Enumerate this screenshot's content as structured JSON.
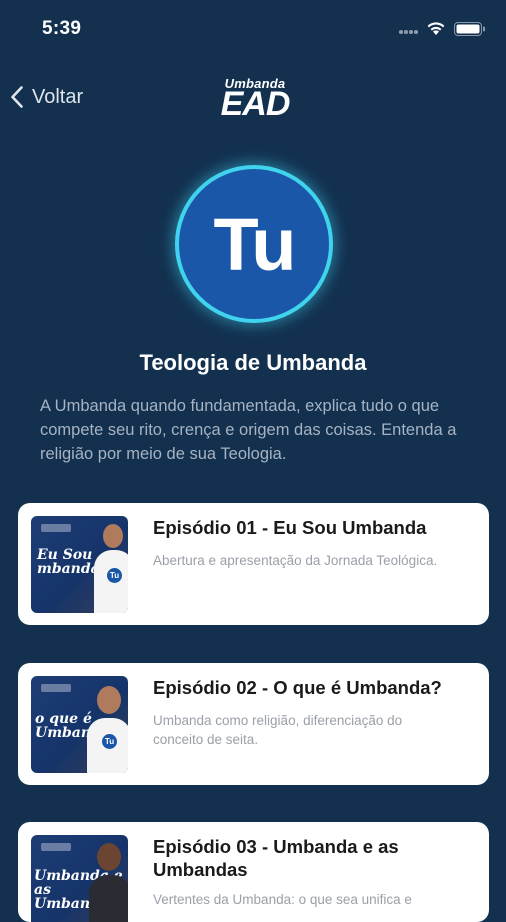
{
  "status_bar": {
    "time": "5:39"
  },
  "nav": {
    "back_label": "Voltar",
    "logo_top": "Umbanda",
    "logo_main": "EAD"
  },
  "course": {
    "badge_text": "Tu",
    "title": "Teologia de Umbanda",
    "description": "A Umbanda quando fundamentada, explica tudo o que compete seu rito, crença e origem das coisas. Entenda a religião por meio de sua Teologia."
  },
  "episodes": [
    {
      "title": "Episódio 01 - Eu Sou Umbanda",
      "description": "Abertura e apresentação da Jornada Teológica."
    },
    {
      "title": "Episódio 02 - O que é Umbanda?",
      "description": "Umbanda como religião, diferenciação do conceito de seita."
    },
    {
      "title": "Episódio 03 - Umbanda e as Umbandas",
      "description": "Vertentes da Umbanda: o que sea unifica e"
    }
  ],
  "colors": {
    "background": "#13304f",
    "badge_fill": "#1b57a8",
    "badge_ring": "#3fd3ee",
    "card": "#ffffff"
  },
  "icons": [
    "chevron-left-icon",
    "wifi-icon",
    "battery-icon",
    "signal-dots-icon"
  ]
}
